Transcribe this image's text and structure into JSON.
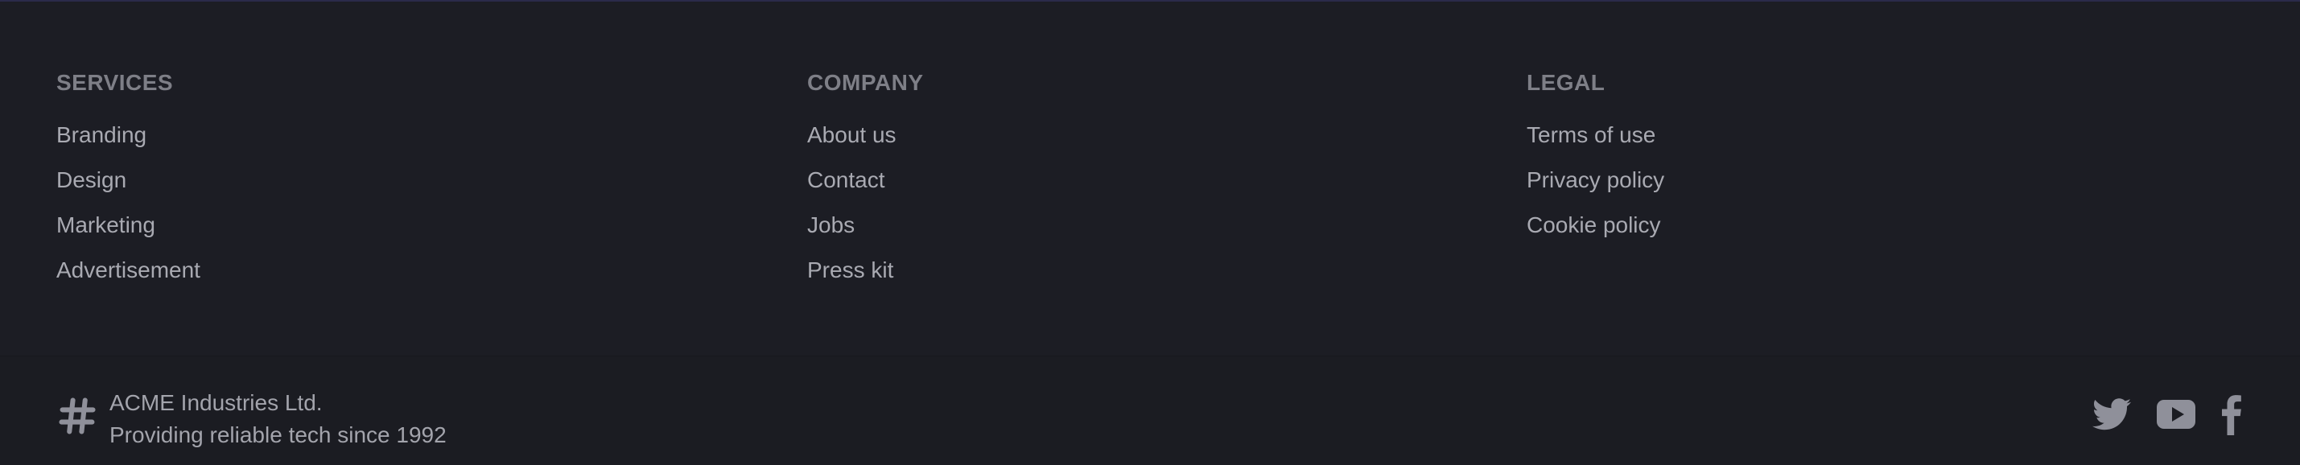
{
  "columns": [
    {
      "title": "SERVICES",
      "links": [
        "Branding",
        "Design",
        "Marketing",
        "Advertisement"
      ]
    },
    {
      "title": "COMPANY",
      "links": [
        "About us",
        "Contact",
        "Jobs",
        "Press kit"
      ]
    },
    {
      "title": "LEGAL",
      "links": [
        "Terms of use",
        "Privacy policy",
        "Cookie policy"
      ]
    }
  ],
  "brand": {
    "name": "ACME Industries Ltd.",
    "tagline": "Providing reliable tech since 1992",
    "icon": "hash-icon"
  },
  "social": {
    "icons": [
      "twitter-icon",
      "youtube-icon",
      "facebook-icon"
    ]
  },
  "colors": {
    "background": "#1c1d24",
    "heading": "#7e7f87",
    "link": "#a9aab2",
    "icon": "#8f909a"
  }
}
